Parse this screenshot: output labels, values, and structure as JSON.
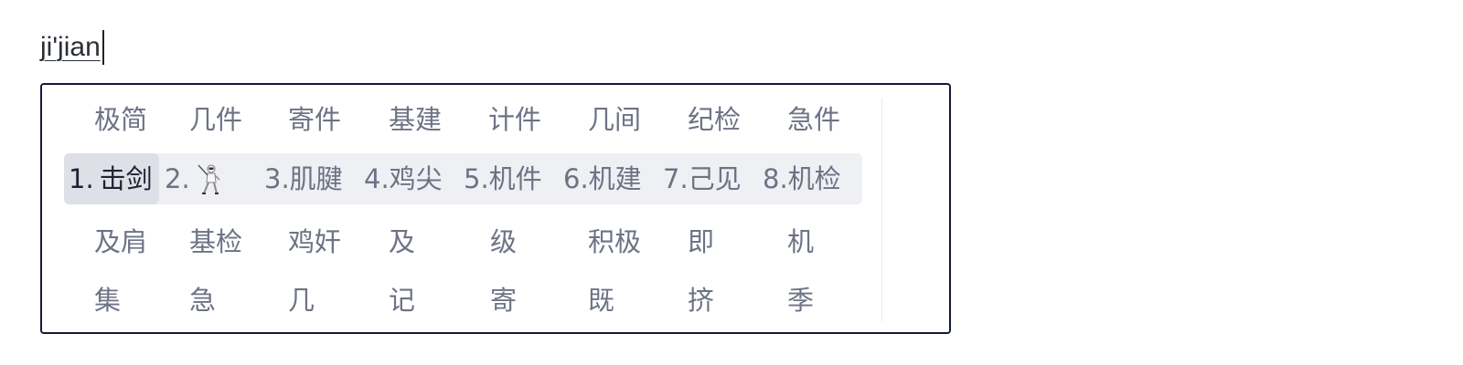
{
  "composition": {
    "text": "ji'jian"
  },
  "candidates": {
    "row1": [
      "极简",
      "几件",
      "寄件",
      "基建",
      "计件",
      "几间",
      "纪检",
      "急件"
    ],
    "row2": [
      {
        "index": "1.",
        "text": "击剑"
      },
      {
        "index": "2.",
        "text": "",
        "icon": "fencing-emoji-icon"
      },
      {
        "index": "3.",
        "text": "肌腱"
      },
      {
        "index": "4.",
        "text": "鸡尖"
      },
      {
        "index": "5.",
        "text": "机件"
      },
      {
        "index": "6.",
        "text": "机建"
      },
      {
        "index": "7.",
        "text": "己见"
      },
      {
        "index": "8.",
        "text": "机检"
      }
    ],
    "row3": [
      "及肩",
      "基检",
      "鸡奸",
      "及",
      "级",
      "积极",
      "即",
      "机"
    ],
    "row4": [
      "集",
      "急",
      "几",
      "记",
      "寄",
      "既",
      "挤",
      "季"
    ]
  },
  "selected_index": 1,
  "colors": {
    "panel_border": "#131a3a",
    "active_row_bg": "#eef0f3",
    "selected_bg": "#dde0e6",
    "candidate_text": "#6d7385",
    "selected_text": "#1e2233"
  }
}
